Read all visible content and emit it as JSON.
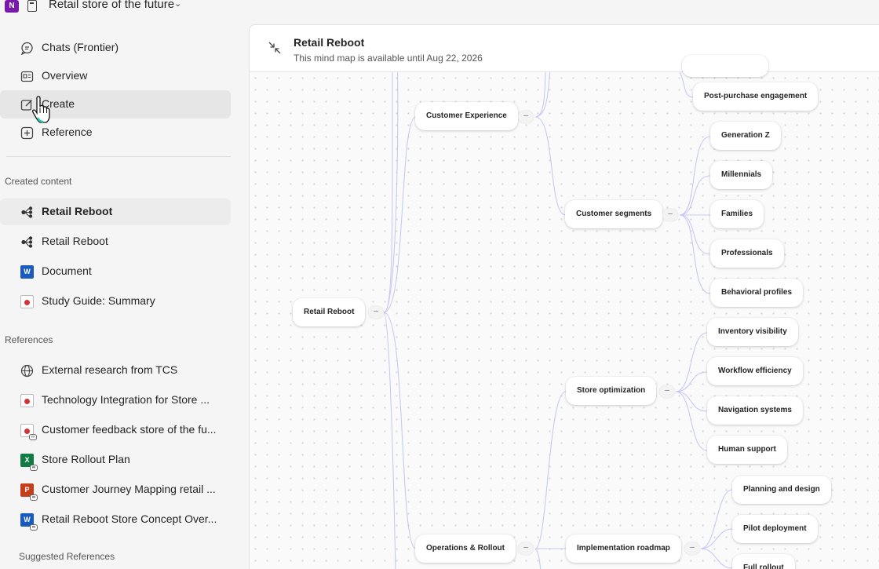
{
  "topbar": {
    "notebook_title": "Retail store of the future",
    "app_icon": "N"
  },
  "nav": [
    {
      "label": "Chats (Frontier)",
      "icon": "chat-icon"
    },
    {
      "label": "Overview",
      "icon": "overview-icon"
    },
    {
      "label": "Create",
      "icon": "edit-icon"
    },
    {
      "label": "Reference",
      "icon": "add-icon"
    }
  ],
  "sections": {
    "created": "Created content",
    "references": "References",
    "suggested": "Suggested References"
  },
  "created_content": [
    {
      "label": "Retail Reboot",
      "icon": "mindmap-icon"
    },
    {
      "label": "Retail Reboot",
      "icon": "mindmap-icon"
    },
    {
      "label": "Document",
      "icon": "word-icon"
    },
    {
      "label": "Study Guide: Summary",
      "icon": "pdf-icon"
    }
  ],
  "references": [
    {
      "label": "External research from TCS",
      "icon": "globe-icon"
    },
    {
      "label": "Technology Integration for Store ...",
      "icon": "pdf-icon"
    },
    {
      "label": "Customer feedback store of the fu...",
      "icon": "pdf-link-icon"
    },
    {
      "label": "Store Rollout Plan",
      "icon": "excel-link-icon"
    },
    {
      "label": "Customer Journey Mapping retail ...",
      "icon": "ppt-link-icon"
    },
    {
      "label": "Retail Reboot Store Concept Over...",
      "icon": "word-link-icon"
    }
  ],
  "main": {
    "title": "Retail Reboot",
    "subtitle": "This mind map is available until Aug 22, 2026",
    "toggle_symbol": "–"
  },
  "mindmap": {
    "root": "Retail Reboot",
    "customer_experience": "Customer Experience",
    "post_purchase": "Post-purchase engagement",
    "customer_segments": "Customer segments",
    "segments": [
      "Generation Z",
      "Millennials",
      "Families",
      "Professionals",
      "Behavioral profiles"
    ],
    "store_optimization": "Store optimization",
    "optimizations": [
      "Inventory visibility",
      "Workflow efficiency",
      "Navigation systems",
      "Human support"
    ],
    "operations": "Operations & Rollout",
    "implementation": "Implementation roadmap",
    "roadmap": [
      "Planning and design",
      "Pilot deployment",
      "Full rollout"
    ]
  }
}
